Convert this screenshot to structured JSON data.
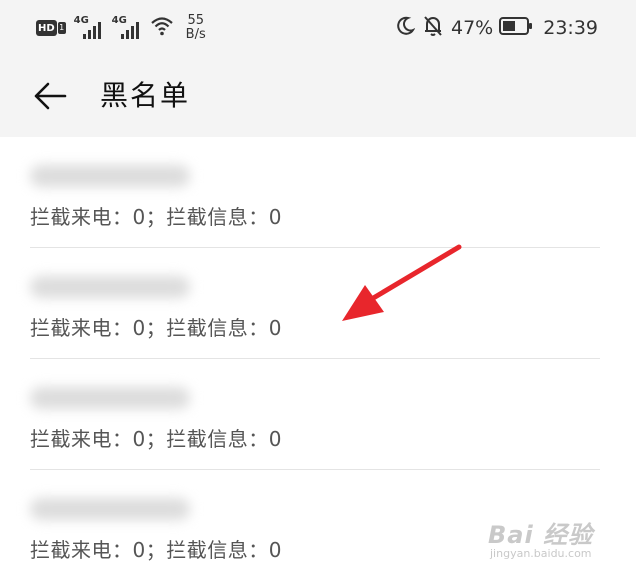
{
  "status_bar": {
    "hd_label": "HD",
    "sim1": "1",
    "net1_gen": "4G",
    "net2_gen": "4G",
    "speed_value": "55",
    "speed_unit": "B/s",
    "battery_percent": "47%",
    "time": "23:39",
    "icons": [
      "moon-icon",
      "bell-off-icon",
      "battery-icon",
      "wifi-icon",
      "signal-icon"
    ]
  },
  "header": {
    "title": "黑名单",
    "back_icon": "arrow-left-icon"
  },
  "entries": [
    {
      "number": "",
      "info": "拦截来电：0；拦截信息：0"
    },
    {
      "number": "",
      "info": "拦截来电：0；拦截信息：0"
    },
    {
      "number": "",
      "info": "拦截来电：0；拦截信息：0"
    },
    {
      "number": "",
      "info": "拦截来电：0；拦截信息：0"
    }
  ],
  "annotation": {
    "color": "#e8262c"
  },
  "watermark": {
    "brand": "Bai 经验",
    "url": "jingyan.baidu.com"
  },
  "colors": {
    "header_bg": "#f4f4f4",
    "divider": "#e4e4e4",
    "annotation_arrow": "#e8262c"
  }
}
